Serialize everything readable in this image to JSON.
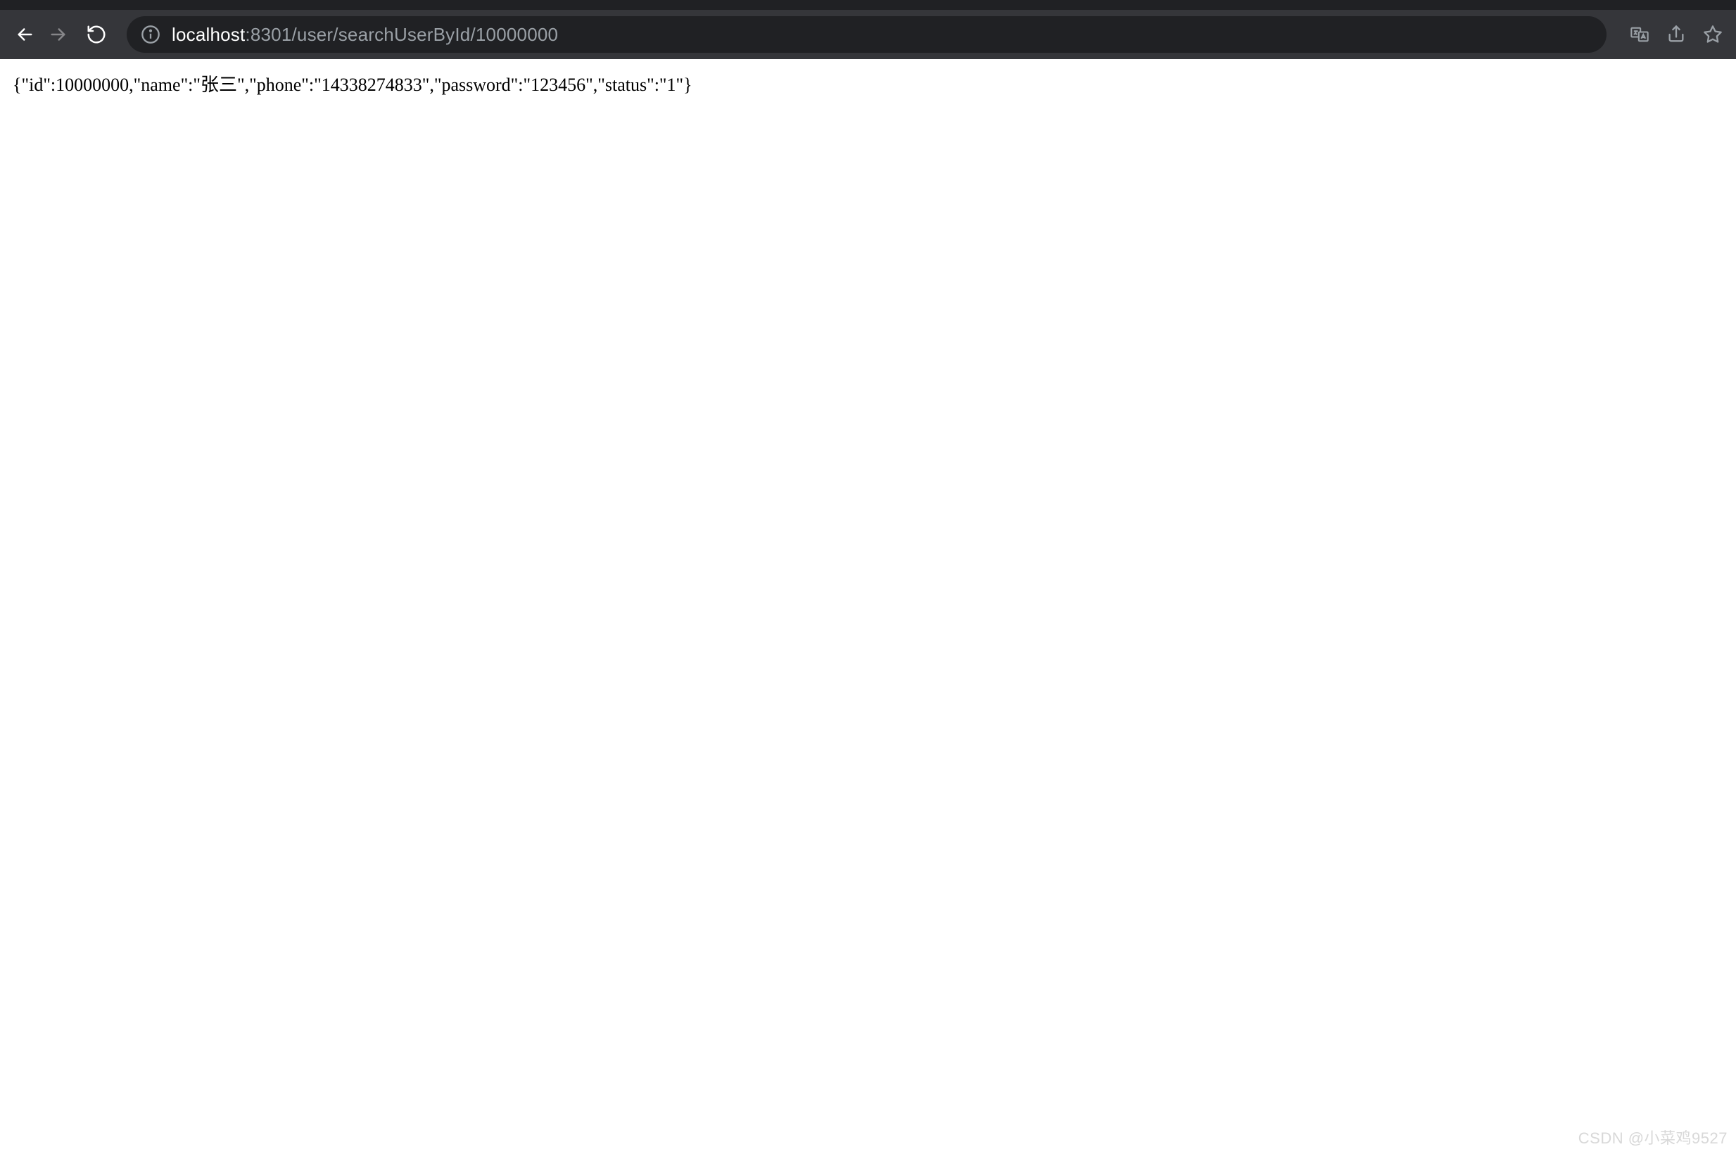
{
  "url": {
    "host": "localhost",
    "path": ":8301/user/searchUserById/10000000"
  },
  "response": {
    "id": 10000000,
    "name": "张三",
    "phone": "14338274833",
    "password": "123456",
    "status": "1"
  },
  "response_text": "{\"id\":10000000,\"name\":\"张三\",\"phone\":\"14338274833\",\"password\":\"123456\",\"status\":\"1\"}",
  "watermark": "CSDN @小菜鸡9527",
  "tab_icons": [
    {
      "color": "#e8710a",
      "width": 190
    },
    {
      "color": "#e8710a",
      "width": 190
    },
    {
      "color": "#e8710a",
      "width": 190
    },
    {
      "color": "#4285f4",
      "width": 190
    },
    {
      "color": "#e8710a",
      "width": 190
    },
    {
      "color": "#e8710a",
      "width": 190
    },
    {
      "color": "#e8710a",
      "width": 190
    }
  ]
}
